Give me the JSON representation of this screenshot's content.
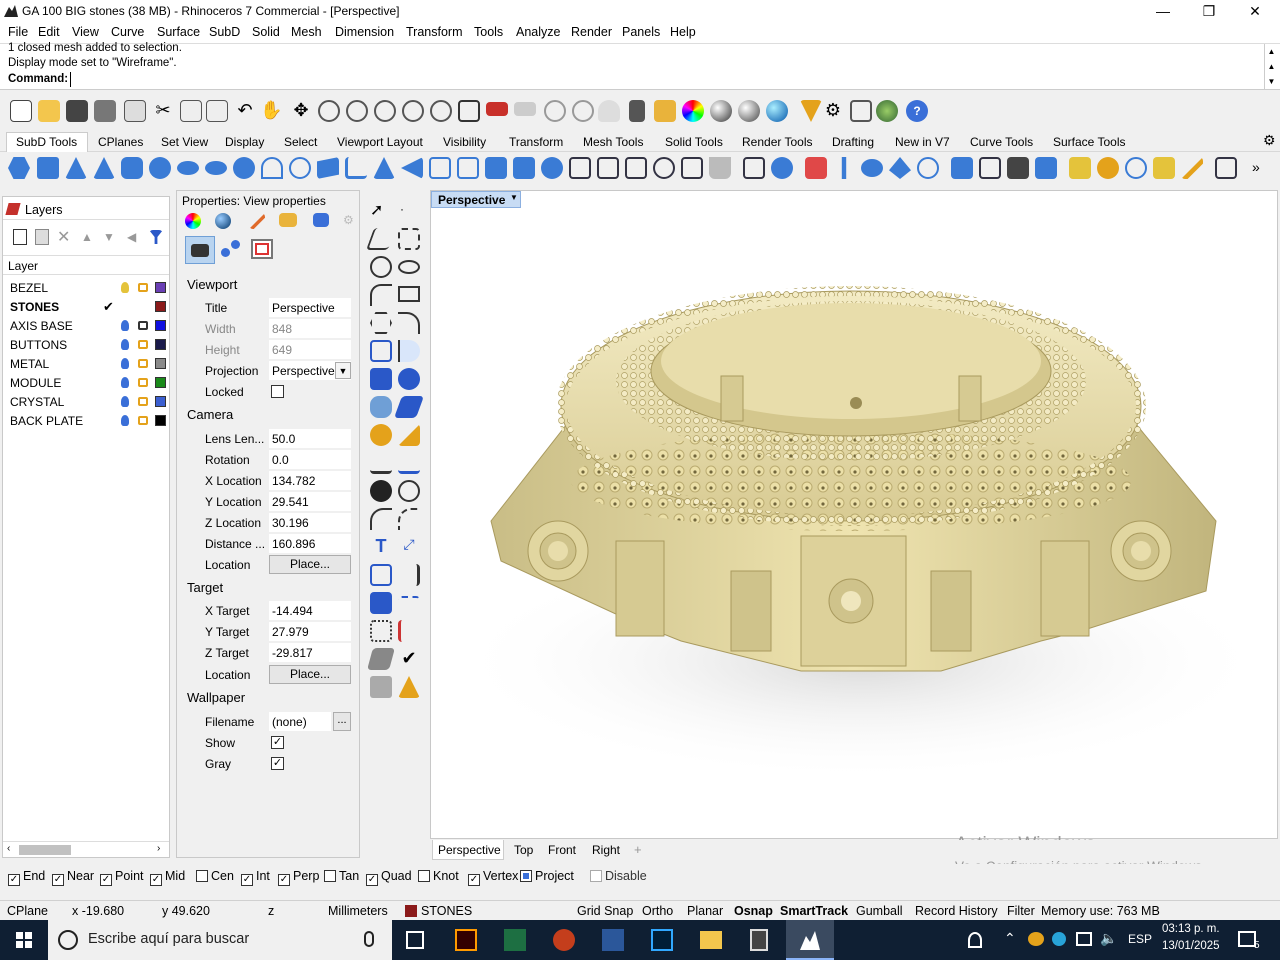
{
  "titlebar": {
    "title": "GA 100 BIG stones (38 MB) - Rhinoceros 7 Commercial - [Perspective]",
    "minimize": "—",
    "maximize": "❐",
    "close": "✕"
  },
  "menu": [
    "File",
    "Edit",
    "View",
    "Curve",
    "Surface",
    "SubD",
    "Solid",
    "Mesh",
    "Dimension",
    "Transform",
    "Tools",
    "Analyze",
    "Render",
    "Panels",
    "Help"
  ],
  "command": {
    "line1": "1 closed mesh added to selection.",
    "line2": "Display mode set to \"Wireframe\".",
    "prompt": "Command:"
  },
  "tabs": [
    "SubD Tools",
    "CPlanes",
    "Set View",
    "Display",
    "Select",
    "Viewport Layout",
    "Visibility",
    "Transform",
    "Mesh Tools",
    "Solid Tools",
    "Render Tools",
    "Drafting",
    "New in V7",
    "Curve Tools",
    "Surface Tools"
  ],
  "layers_panel": {
    "title": "Layers",
    "header": "Layer",
    "items": [
      {
        "name": "BEZEL",
        "color": "#6a3fb5",
        "current": false
      },
      {
        "name": "STONES",
        "color": "#8b1a1a",
        "current": true
      },
      {
        "name": "AXIS BASE",
        "color": "#1010e0",
        "current": false
      },
      {
        "name": "BUTTONS",
        "color": "#1a1a4a",
        "current": false
      },
      {
        "name": "METAL",
        "color": "#8a8a8a",
        "current": false
      },
      {
        "name": "MODULE",
        "color": "#1a8a1a",
        "current": false
      },
      {
        "name": "CRYSTAL",
        "color": "#3b5fd0",
        "current": false
      },
      {
        "name": "BACK PLATE",
        "color": "#000000",
        "current": false
      }
    ],
    "current_mark": "✔"
  },
  "properties": {
    "title": "Properties: View properties",
    "viewport": {
      "section": "Viewport",
      "title_label": "Title",
      "title": "Perspective",
      "width_label": "Width",
      "width": "848",
      "height_label": "Height",
      "height": "649",
      "projection_label": "Projection",
      "projection": "Perspective",
      "locked_label": "Locked"
    },
    "camera": {
      "section": "Camera",
      "lens_label": "Lens Len...",
      "lens": "50.0",
      "rotation_label": "Rotation",
      "rotation": "0.0",
      "x_label": "X Location",
      "x": "134.782",
      "y_label": "Y Location",
      "y": "29.541",
      "z_label": "Z Location",
      "z": "30.196",
      "dist_label": "Distance ...",
      "dist": "160.896",
      "loc_label": "Location",
      "place": "Place..."
    },
    "target": {
      "section": "Target",
      "x_label": "X Target",
      "x": "-14.494",
      "y_label": "Y Target",
      "y": "27.979",
      "z_label": "Z Target",
      "z": "-29.817",
      "loc_label": "Location",
      "place": "Place..."
    },
    "wallpaper": {
      "section": "Wallpaper",
      "file_label": "Filename",
      "file": "(none)",
      "browse": "...",
      "show_label": "Show",
      "gray_label": "Gray",
      "checked": "✓"
    }
  },
  "viewport": {
    "label": "Perspective",
    "tabs": [
      "Perspective",
      "Top",
      "Front",
      "Right"
    ],
    "add": "+"
  },
  "watermark": {
    "line1": "Activar Windows",
    "line2": "Ve a Configuración para activar Windows."
  },
  "osnaps": [
    {
      "label": "End",
      "checked": true
    },
    {
      "label": "Near",
      "checked": true
    },
    {
      "label": "Point",
      "checked": true
    },
    {
      "label": "Mid",
      "checked": true
    },
    {
      "label": "Cen",
      "checked": false
    },
    {
      "label": "Int",
      "checked": true
    },
    {
      "label": "Perp",
      "checked": true
    },
    {
      "label": "Tan",
      "checked": false
    },
    {
      "label": "Quad",
      "checked": true
    },
    {
      "label": "Knot",
      "checked": false
    },
    {
      "label": "Vertex",
      "checked": true
    },
    {
      "label": "Project",
      "checked": false
    },
    {
      "label": "Disable",
      "checked": false
    }
  ],
  "status": {
    "cplane": "CPlane",
    "x": "x -19.680",
    "y": "y 49.620",
    "z": "z",
    "units": "Millimeters",
    "layer": "STONES",
    "layer_color": "#8b1a1a",
    "gridsnap": "Grid Snap",
    "ortho": "Ortho",
    "planar": "Planar",
    "osnap": "Osnap",
    "smarttrack": "SmartTrack",
    "gumball": "Gumball",
    "history": "Record History",
    "filter": "Filter",
    "memory": "Memory use: 763 MB"
  },
  "taskbar": {
    "search": "Escribe aquí para buscar",
    "lang": "ESP",
    "time": "03:13 p. m.",
    "date": "13/01/2025",
    "notif": "5"
  }
}
